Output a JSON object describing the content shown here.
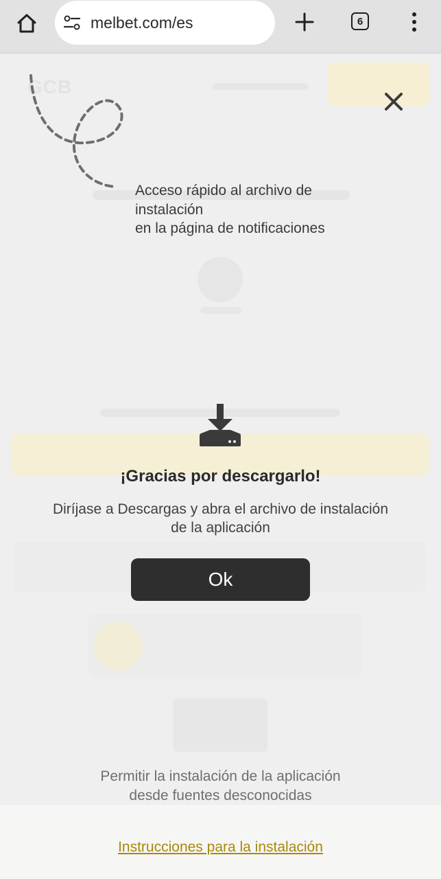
{
  "browser": {
    "url": "melbet.com/es",
    "tab_count": "6",
    "icons": {
      "home": "home-icon",
      "site_settings": "tune-icon",
      "new_tab": "plus-icon",
      "tabs": "tabs-icon",
      "menu": "more-vert-icon"
    }
  },
  "overlay": {
    "hint": "Acceso rápido al archivo de instalación\nen la página de notificaciones",
    "title": "¡Gracias por descargarlo!",
    "description": "Diríjase a Descargas y abra el archivo de instalación de la aplicación",
    "ok_label": "Ok",
    "permit_text": "Permitir la instalación de la aplicación desde fuentes desconocidas",
    "install_link": "Instrucciones para la instalación",
    "colors": {
      "button_bg": "#2e2e2e",
      "link": "#a8880a",
      "text": "#2a2a2a"
    }
  }
}
